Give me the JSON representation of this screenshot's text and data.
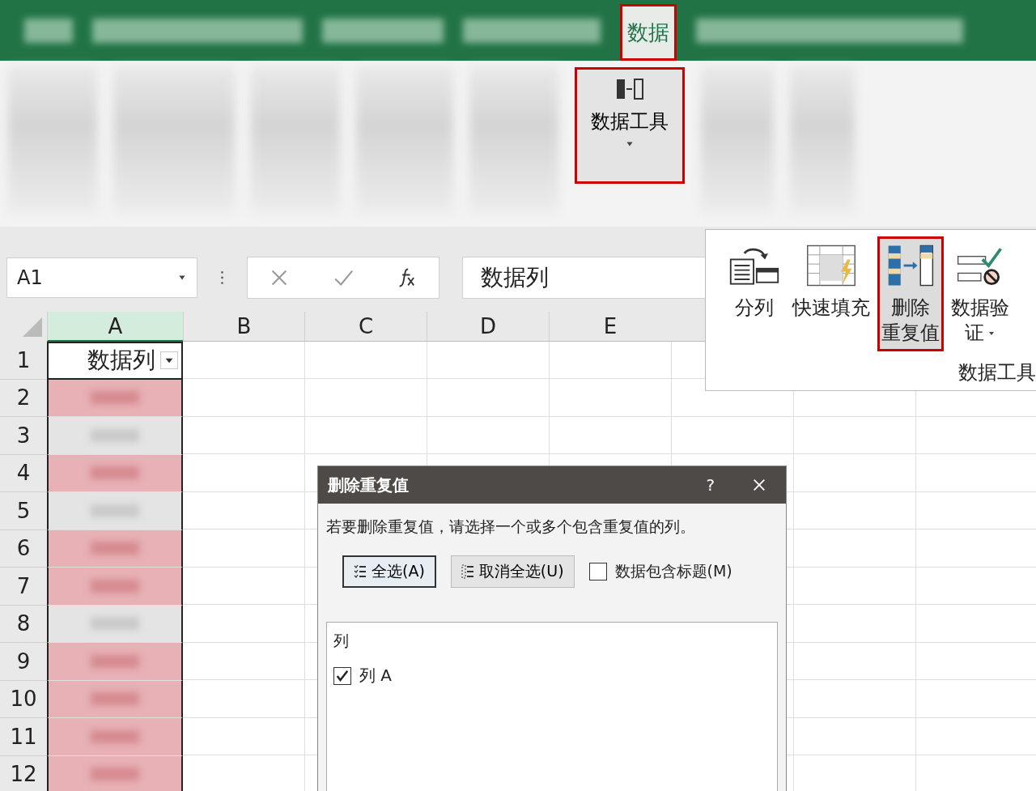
{
  "ribbon": {
    "tabs": [
      {
        "label": "数据",
        "selected": true
      }
    ],
    "group_button": {
      "label": "数据工具",
      "selected": true
    }
  },
  "formula_bar": {
    "name_box": "A1",
    "formula": "数据列"
  },
  "columns": [
    "A",
    "B",
    "C",
    "D",
    "E"
  ],
  "header_row": {
    "number": "1",
    "value": "数据列"
  },
  "rows": [
    {
      "number": "2",
      "highlighted": true
    },
    {
      "number": "3",
      "highlighted": false
    },
    {
      "number": "4",
      "highlighted": true
    },
    {
      "number": "5",
      "highlighted": false
    },
    {
      "number": "6",
      "highlighted": true
    },
    {
      "number": "7",
      "highlighted": true
    },
    {
      "number": "8",
      "highlighted": false
    },
    {
      "number": "9",
      "highlighted": true
    },
    {
      "number": "10",
      "highlighted": true
    },
    {
      "number": "11",
      "highlighted": true
    },
    {
      "number": "12",
      "highlighted": true
    }
  ],
  "tools_panel": {
    "items": [
      {
        "kind": "split",
        "lines": [
          "分列"
        ],
        "selected": false,
        "dropdown": false
      },
      {
        "kind": "flash-fill",
        "lines": [
          "快速填充"
        ],
        "selected": false,
        "dropdown": false
      },
      {
        "kind": "remove-duplicates",
        "lines": [
          "删除",
          "重复值"
        ],
        "selected": true,
        "dropdown": false
      },
      {
        "kind": "validation",
        "lines": [
          "数据验",
          "证"
        ],
        "selected": false,
        "dropdown": true
      }
    ],
    "group_label": "数据工具"
  },
  "dialog": {
    "title": "删除重复值",
    "help": "?",
    "message": "若要删除重复值，请选择一个或多个包含重复值的列。",
    "buttons": [
      {
        "kind": "select-all",
        "label": "全选(A)",
        "selected": true
      },
      {
        "kind": "unselect-all",
        "label": "取消全选(U)",
        "selected": false
      }
    ],
    "header_checkbox": {
      "label": "数据包含标题(M)",
      "checked": false
    },
    "list_header": "列",
    "list_items": [
      {
        "label": "列 A",
        "checked": true
      }
    ]
  }
}
